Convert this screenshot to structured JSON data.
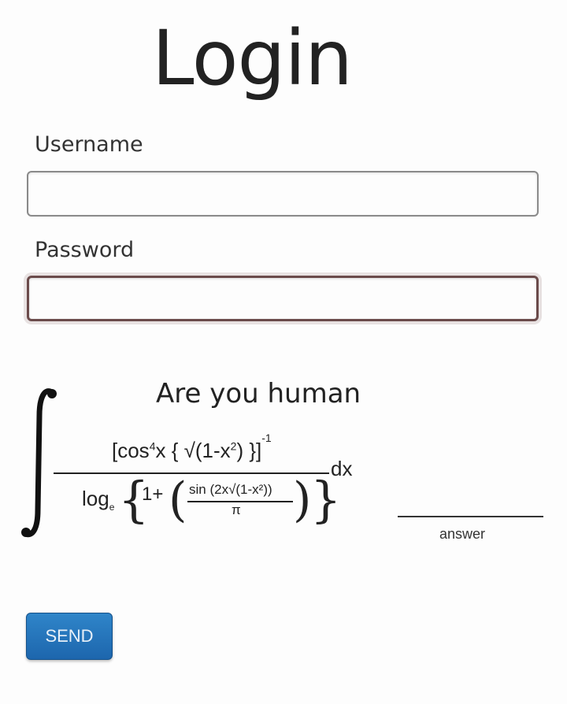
{
  "page": {
    "title": "Login"
  },
  "form": {
    "username_label": "Username",
    "username_value": "",
    "password_label": "Password",
    "password_value": ""
  },
  "captcha": {
    "prompt": "Are you human",
    "numerator_a": "[cos",
    "numerator_a_sup": "4",
    "numerator_b": "x { √(1-x",
    "numerator_b_sup": "2",
    "numerator_c": ") }]",
    "numerator_exponent": "-1",
    "differential": "dx",
    "den_log": "log",
    "den_log_base": "e",
    "den_open_brace": "{",
    "den_one_plus": "1+",
    "den_open_paren": "(",
    "den_inner_numerator": "sin (2x√(1-x²))",
    "den_inner_denominator": "π",
    "den_close_paren": ")",
    "den_close_brace": "}",
    "answer_value": "",
    "answer_caption": "answer"
  },
  "actions": {
    "send_label": "SEND"
  },
  "colors": {
    "send_button": "#1f6fb6",
    "focus_border": "#6b4b4b"
  }
}
